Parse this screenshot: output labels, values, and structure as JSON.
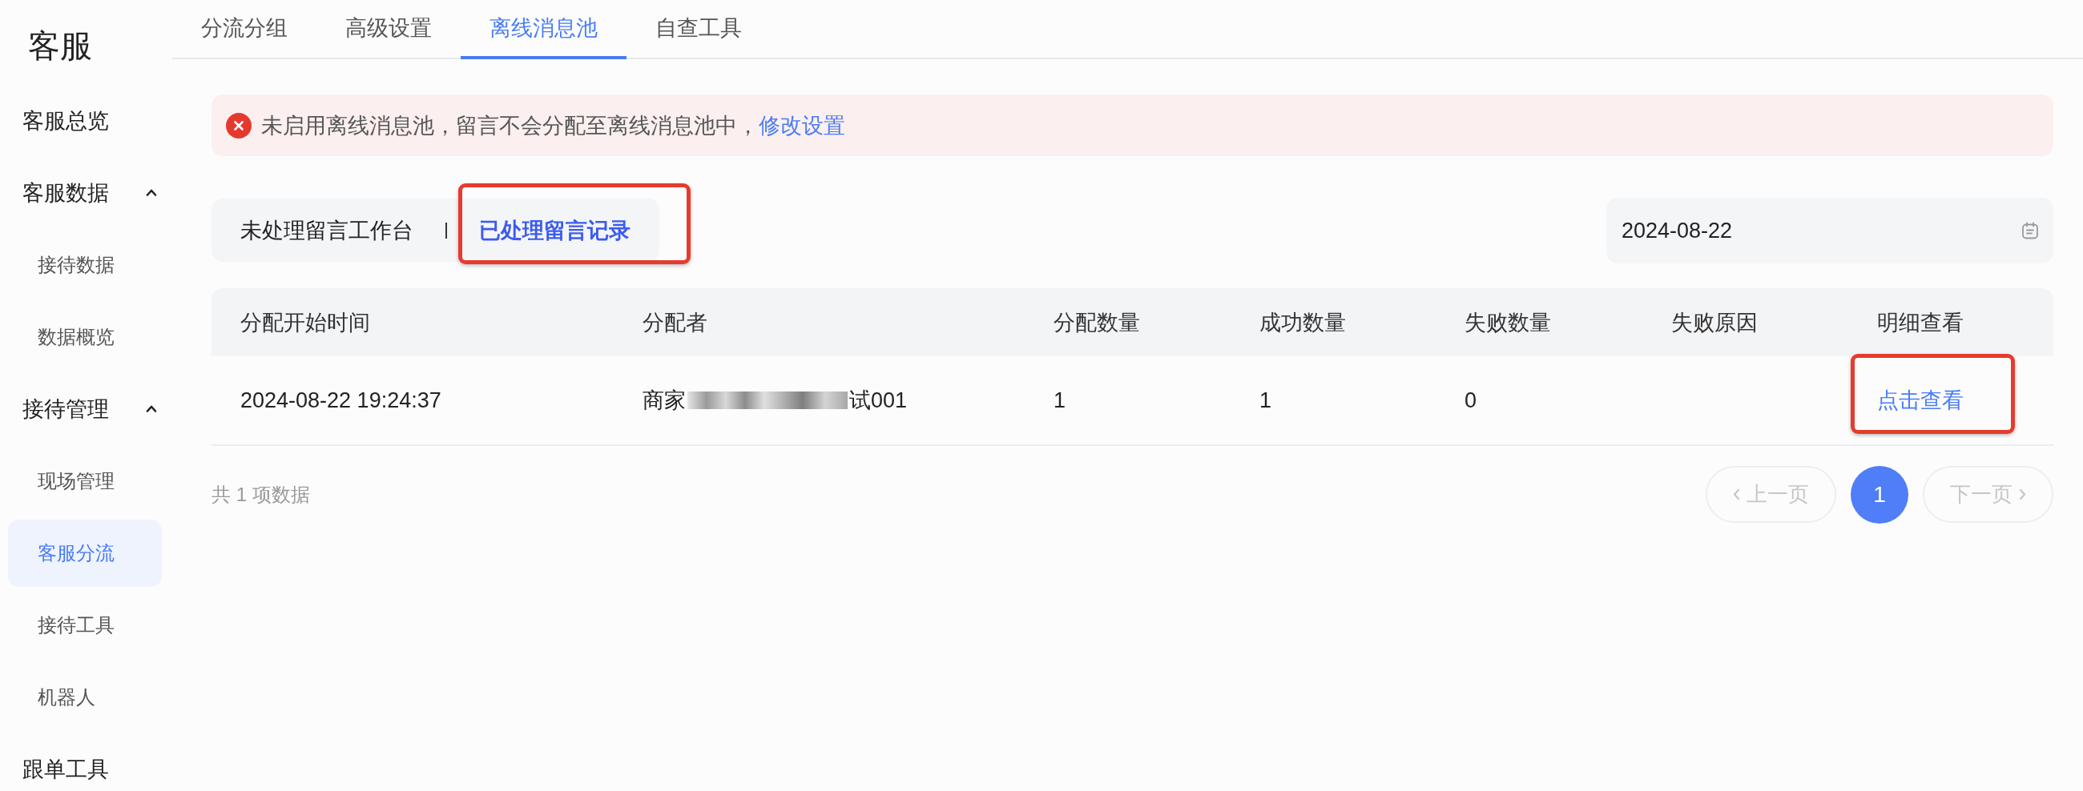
{
  "sidebar": {
    "title": "客服",
    "items": [
      {
        "kind": "link",
        "label": "客服总览",
        "selected": false
      },
      {
        "kind": "group",
        "label": "客服数据",
        "selected": false,
        "expanded": true,
        "children": [
          {
            "label": "接待数据",
            "selected": false
          },
          {
            "label": "数据概览",
            "selected": false
          }
        ]
      },
      {
        "kind": "group",
        "label": "接待管理",
        "selected": false,
        "expanded": true,
        "children": [
          {
            "label": "现场管理",
            "selected": false
          },
          {
            "label": "客服分流",
            "selected": true
          },
          {
            "label": "接待工具",
            "selected": false
          },
          {
            "label": "机器人",
            "selected": false
          }
        ]
      },
      {
        "kind": "link",
        "label": "跟单工具",
        "selected": false
      }
    ]
  },
  "tabs": [
    {
      "label": "分流分组",
      "selected": false
    },
    {
      "label": "高级设置",
      "selected": false
    },
    {
      "label": "离线消息池",
      "selected": true
    },
    {
      "label": "自查工具",
      "selected": false
    }
  ],
  "alert": {
    "kind": "error",
    "message": "未启用离线消息池，留言不会分配至离线消息池中，",
    "link": "修改设置"
  },
  "sub_tabs": [
    {
      "label": "未处理留言工作台",
      "selected": false,
      "highlighted": false
    },
    {
      "label": "已处理留言记录",
      "selected": true,
      "highlighted": true
    }
  ],
  "date_field": {
    "value": "2024-08-22"
  },
  "table": {
    "columns": [
      "分配开始时间",
      "分配者",
      "分配数量",
      "成功数量",
      "失败数量",
      "失败原因",
      "明细查看"
    ],
    "rows": [
      {
        "cells": [
          {
            "kind": "text",
            "text": "2024-08-22 19:24:37"
          },
          {
            "kind": "redacted",
            "parts": [
              "商家",
              "试001"
            ]
          },
          {
            "kind": "text",
            "text": "1"
          },
          {
            "kind": "text",
            "text": "1"
          },
          {
            "kind": "text",
            "text": "0"
          },
          null,
          {
            "kind": "link",
            "text": "点击查看",
            "highlighted": true
          }
        ]
      }
    ]
  },
  "pagination": {
    "summary": "共 1 项数据",
    "prev": {
      "label": "上一页",
      "disabled": true
    },
    "pages": [
      {
        "label": "1",
        "selected": true
      }
    ],
    "next": {
      "label": "下一页",
      "disabled": true
    }
  }
}
